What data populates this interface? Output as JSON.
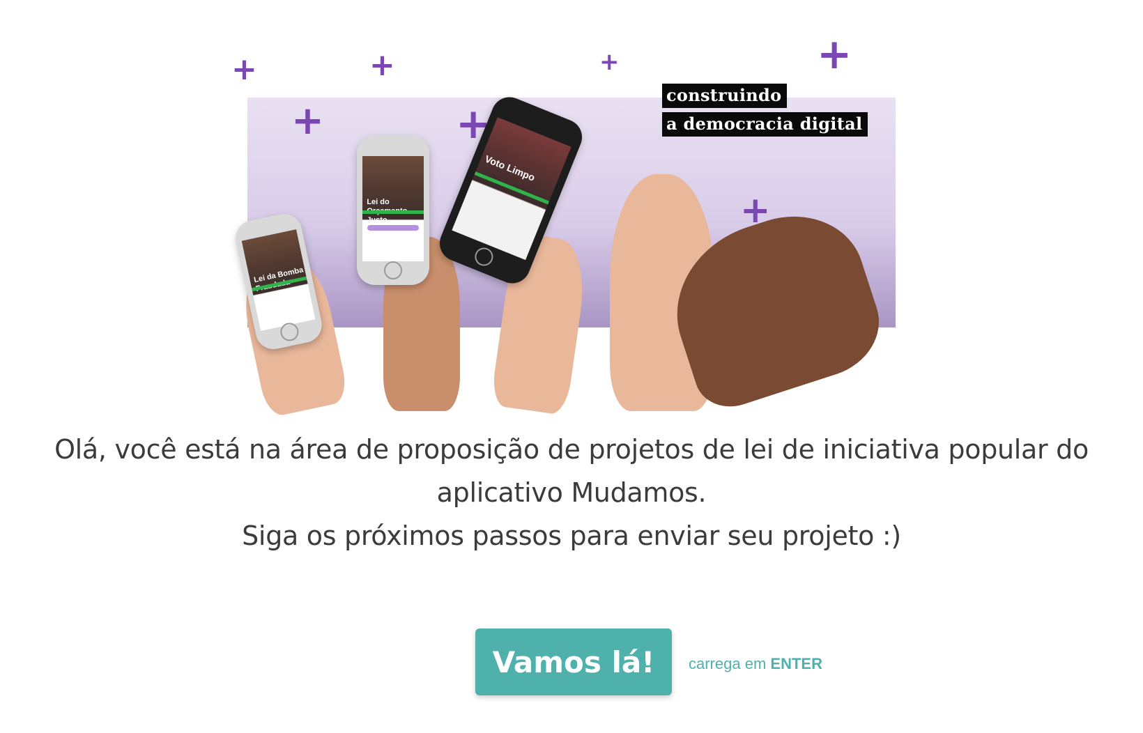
{
  "hero": {
    "tagline_line1": "construindo",
    "tagline_line2": "a democracia digital",
    "phones": [
      {
        "screen_title": "Lei da Bomba Fraudada"
      },
      {
        "screen_title": "Lei do Orçamento Justo"
      },
      {
        "screen_title": "Voto Limpo"
      }
    ]
  },
  "intro": {
    "line1": "Olá, você está na área de proposição de projetos de lei de iniciativa popular do",
    "line2": "aplicativo Mudamos.",
    "line3": "Siga os próximos passos para enviar seu projeto :)"
  },
  "cta": {
    "button_label": "Vamos lá!",
    "hint_prefix": "carrega em",
    "hint_key": "ENTER"
  },
  "colors": {
    "accent": "#4fb1ab",
    "plus": "#7b48b3",
    "text": "#3b3b3b"
  }
}
